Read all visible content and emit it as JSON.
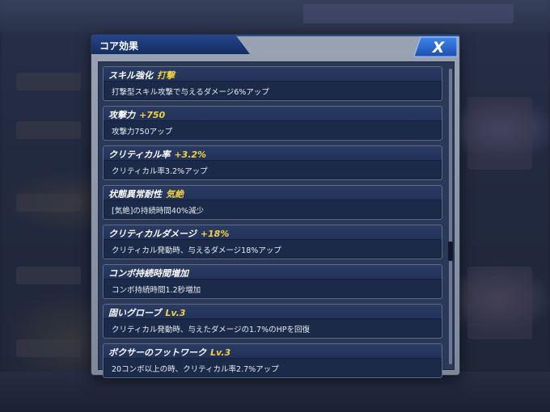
{
  "dialog": {
    "title": "コア効果",
    "close_label": "X"
  },
  "effects": [
    {
      "name": "スキル強化",
      "value": "打撃",
      "description": "打撃型スキル攻撃で与えるダメージ6%アップ"
    },
    {
      "name": "攻撃力",
      "value": "+750",
      "description": "攻撃力750アップ"
    },
    {
      "name": "クリティカル率",
      "value": "+3.2%",
      "description": "クリティカル率3.2%アップ"
    },
    {
      "name": "状態異常耐性",
      "value": "気絶",
      "description": "[気絶]の持続時間40%減少"
    },
    {
      "name": "クリティカルダメージ",
      "value": "+18%",
      "description": "クリティカル発動時、与えるダメージ18%アップ"
    },
    {
      "name": "コンボ持続時間増加",
      "value": "",
      "description": "コンボ持続時間1.2秒増加"
    },
    {
      "name": "固いグローブ",
      "value": "Lv.3",
      "description": "クリティカル発動時、与えたダメージの1.7%のHPを回復"
    },
    {
      "name": "ボクサーのフットワーク",
      "value": "Lv.3",
      "description": "20コンボ以上の時、クリティカル率2.7%アップ"
    }
  ],
  "colors": {
    "accent_value": "#f4d33a",
    "title_bar": "#1b3a7a",
    "close_button": "#2a62c8",
    "card_background": "#1c2a49"
  }
}
